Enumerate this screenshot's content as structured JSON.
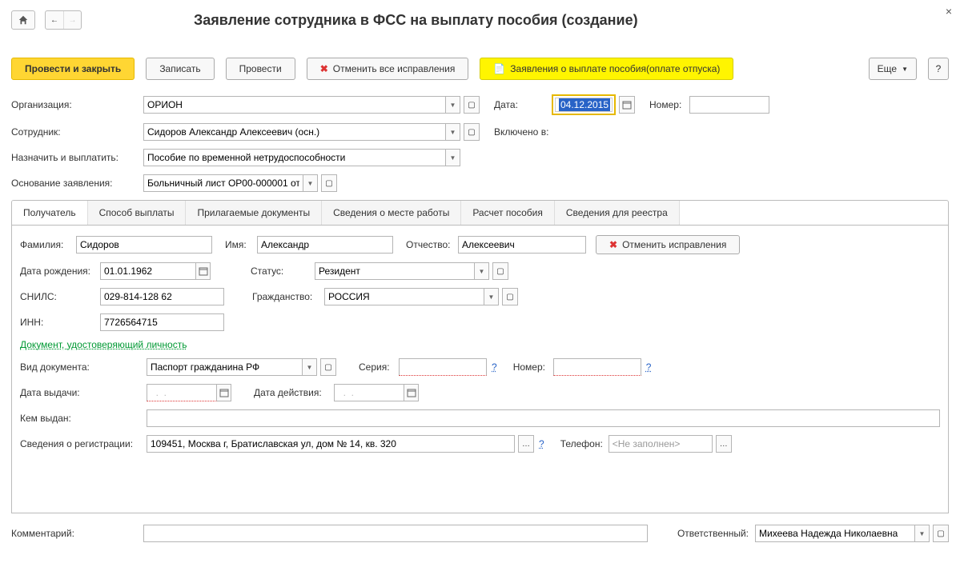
{
  "title": "Заявление сотрудника в ФСС на выплату пособия (создание)",
  "toolbar": {
    "postclose": "Провести и закрыть",
    "save": "Записать",
    "post": "Провести",
    "cancelall": "Отменить все исправления",
    "related": "Заявления о выплате пособия(оплате отпуска)",
    "more": "Еще",
    "help": "?"
  },
  "labels": {
    "org": "Организация:",
    "date": "Дата:",
    "number": "Номер:",
    "emp": "Сотрудник:",
    "included": "Включено в:",
    "assignpay": "Назначить и выплатить:",
    "basis": "Основание заявления:",
    "surname": "Фамилия:",
    "name": "Имя:",
    "patronym": "Отчество:",
    "cancelfix": "Отменить исправления",
    "birth": "Дата рождения:",
    "status": "Статус:",
    "snils": "СНИЛС:",
    "citizen": "Гражданство:",
    "inn": "ИНН:",
    "docsection": "Документ, удостоверяющий личность",
    "doctype": "Вид документа:",
    "series": "Серия:",
    "docnum": "Номер:",
    "issuedate": "Дата выдачи:",
    "validdate": "Дата действия:",
    "issuedby": "Кем выдан:",
    "reginfo": "Сведения о регистрации:",
    "phone": "Телефон:",
    "comment": "Комментарий:",
    "responsible": "Ответственный:"
  },
  "values": {
    "org": "ОРИОН",
    "date": "04.12.2015",
    "number": "",
    "emp": "Сидоров Александр Алексеевич (осн.)",
    "assignpay": "Пособие по временной нетрудоспособности",
    "basis": "Больничный лист ОР00-000001 от",
    "surname": "Сидоров",
    "name": "Александр",
    "patronym": "Алексеевич",
    "birth": "01.01.1962",
    "status": "Резидент",
    "snils": "029-814-128 62",
    "citizen": "РОССИЯ",
    "inn": "7726564715",
    "doctype": "Паспорт гражданина РФ",
    "series": "",
    "docnum": "",
    "issuedate": "  .  .    ",
    "validdate": "  .  .    ",
    "issuedby": "",
    "reginfo": "109451, Москва г, Братиславская ул, дом № 14, кв. 320",
    "phone": "<Не заполнен>",
    "comment": "",
    "responsible": "Михеева Надежда Николаевна"
  },
  "tabs": [
    "Получатель",
    "Способ выплаты",
    "Прилагаемые документы",
    "Сведения о месте работы",
    "Расчет пособия",
    "Сведения для реестра"
  ]
}
